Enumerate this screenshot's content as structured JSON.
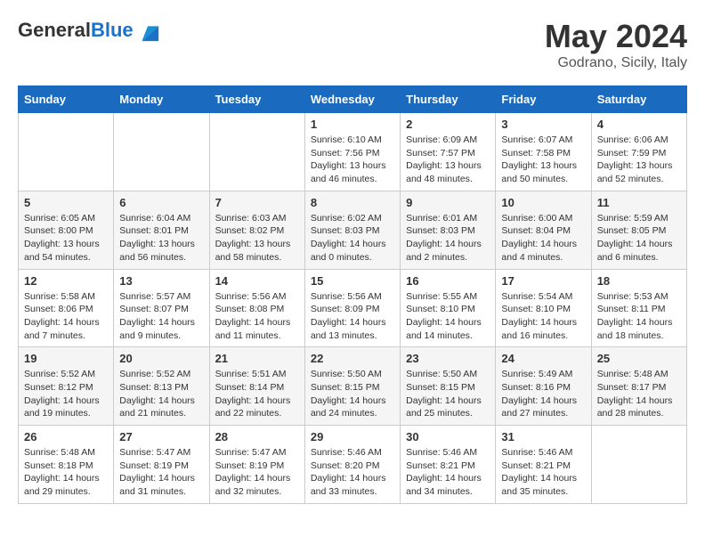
{
  "header": {
    "logo_general": "General",
    "logo_blue": "Blue",
    "month": "May 2024",
    "location": "Godrano, Sicily, Italy"
  },
  "weekdays": [
    "Sunday",
    "Monday",
    "Tuesday",
    "Wednesday",
    "Thursday",
    "Friday",
    "Saturday"
  ],
  "weeks": [
    [
      {
        "day": "",
        "sunrise": "",
        "sunset": "",
        "daylight": ""
      },
      {
        "day": "",
        "sunrise": "",
        "sunset": "",
        "daylight": ""
      },
      {
        "day": "",
        "sunrise": "",
        "sunset": "",
        "daylight": ""
      },
      {
        "day": "1",
        "sunrise": "Sunrise: 6:10 AM",
        "sunset": "Sunset: 7:56 PM",
        "daylight": "Daylight: 13 hours and 46 minutes."
      },
      {
        "day": "2",
        "sunrise": "Sunrise: 6:09 AM",
        "sunset": "Sunset: 7:57 PM",
        "daylight": "Daylight: 13 hours and 48 minutes."
      },
      {
        "day": "3",
        "sunrise": "Sunrise: 6:07 AM",
        "sunset": "Sunset: 7:58 PM",
        "daylight": "Daylight: 13 hours and 50 minutes."
      },
      {
        "day": "4",
        "sunrise": "Sunrise: 6:06 AM",
        "sunset": "Sunset: 7:59 PM",
        "daylight": "Daylight: 13 hours and 52 minutes."
      }
    ],
    [
      {
        "day": "5",
        "sunrise": "Sunrise: 6:05 AM",
        "sunset": "Sunset: 8:00 PM",
        "daylight": "Daylight: 13 hours and 54 minutes."
      },
      {
        "day": "6",
        "sunrise": "Sunrise: 6:04 AM",
        "sunset": "Sunset: 8:01 PM",
        "daylight": "Daylight: 13 hours and 56 minutes."
      },
      {
        "day": "7",
        "sunrise": "Sunrise: 6:03 AM",
        "sunset": "Sunset: 8:02 PM",
        "daylight": "Daylight: 13 hours and 58 minutes."
      },
      {
        "day": "8",
        "sunrise": "Sunrise: 6:02 AM",
        "sunset": "Sunset: 8:03 PM",
        "daylight": "Daylight: 14 hours and 0 minutes."
      },
      {
        "day": "9",
        "sunrise": "Sunrise: 6:01 AM",
        "sunset": "Sunset: 8:03 PM",
        "daylight": "Daylight: 14 hours and 2 minutes."
      },
      {
        "day": "10",
        "sunrise": "Sunrise: 6:00 AM",
        "sunset": "Sunset: 8:04 PM",
        "daylight": "Daylight: 14 hours and 4 minutes."
      },
      {
        "day": "11",
        "sunrise": "Sunrise: 5:59 AM",
        "sunset": "Sunset: 8:05 PM",
        "daylight": "Daylight: 14 hours and 6 minutes."
      }
    ],
    [
      {
        "day": "12",
        "sunrise": "Sunrise: 5:58 AM",
        "sunset": "Sunset: 8:06 PM",
        "daylight": "Daylight: 14 hours and 7 minutes."
      },
      {
        "day": "13",
        "sunrise": "Sunrise: 5:57 AM",
        "sunset": "Sunset: 8:07 PM",
        "daylight": "Daylight: 14 hours and 9 minutes."
      },
      {
        "day": "14",
        "sunrise": "Sunrise: 5:56 AM",
        "sunset": "Sunset: 8:08 PM",
        "daylight": "Daylight: 14 hours and 11 minutes."
      },
      {
        "day": "15",
        "sunrise": "Sunrise: 5:56 AM",
        "sunset": "Sunset: 8:09 PM",
        "daylight": "Daylight: 14 hours and 13 minutes."
      },
      {
        "day": "16",
        "sunrise": "Sunrise: 5:55 AM",
        "sunset": "Sunset: 8:10 PM",
        "daylight": "Daylight: 14 hours and 14 minutes."
      },
      {
        "day": "17",
        "sunrise": "Sunrise: 5:54 AM",
        "sunset": "Sunset: 8:10 PM",
        "daylight": "Daylight: 14 hours and 16 minutes."
      },
      {
        "day": "18",
        "sunrise": "Sunrise: 5:53 AM",
        "sunset": "Sunset: 8:11 PM",
        "daylight": "Daylight: 14 hours and 18 minutes."
      }
    ],
    [
      {
        "day": "19",
        "sunrise": "Sunrise: 5:52 AM",
        "sunset": "Sunset: 8:12 PM",
        "daylight": "Daylight: 14 hours and 19 minutes."
      },
      {
        "day": "20",
        "sunrise": "Sunrise: 5:52 AM",
        "sunset": "Sunset: 8:13 PM",
        "daylight": "Daylight: 14 hours and 21 minutes."
      },
      {
        "day": "21",
        "sunrise": "Sunrise: 5:51 AM",
        "sunset": "Sunset: 8:14 PM",
        "daylight": "Daylight: 14 hours and 22 minutes."
      },
      {
        "day": "22",
        "sunrise": "Sunrise: 5:50 AM",
        "sunset": "Sunset: 8:15 PM",
        "daylight": "Daylight: 14 hours and 24 minutes."
      },
      {
        "day": "23",
        "sunrise": "Sunrise: 5:50 AM",
        "sunset": "Sunset: 8:15 PM",
        "daylight": "Daylight: 14 hours and 25 minutes."
      },
      {
        "day": "24",
        "sunrise": "Sunrise: 5:49 AM",
        "sunset": "Sunset: 8:16 PM",
        "daylight": "Daylight: 14 hours and 27 minutes."
      },
      {
        "day": "25",
        "sunrise": "Sunrise: 5:48 AM",
        "sunset": "Sunset: 8:17 PM",
        "daylight": "Daylight: 14 hours and 28 minutes."
      }
    ],
    [
      {
        "day": "26",
        "sunrise": "Sunrise: 5:48 AM",
        "sunset": "Sunset: 8:18 PM",
        "daylight": "Daylight: 14 hours and 29 minutes."
      },
      {
        "day": "27",
        "sunrise": "Sunrise: 5:47 AM",
        "sunset": "Sunset: 8:19 PM",
        "daylight": "Daylight: 14 hours and 31 minutes."
      },
      {
        "day": "28",
        "sunrise": "Sunrise: 5:47 AM",
        "sunset": "Sunset: 8:19 PM",
        "daylight": "Daylight: 14 hours and 32 minutes."
      },
      {
        "day": "29",
        "sunrise": "Sunrise: 5:46 AM",
        "sunset": "Sunset: 8:20 PM",
        "daylight": "Daylight: 14 hours and 33 minutes."
      },
      {
        "day": "30",
        "sunrise": "Sunrise: 5:46 AM",
        "sunset": "Sunset: 8:21 PM",
        "daylight": "Daylight: 14 hours and 34 minutes."
      },
      {
        "day": "31",
        "sunrise": "Sunrise: 5:46 AM",
        "sunset": "Sunset: 8:21 PM",
        "daylight": "Daylight: 14 hours and 35 minutes."
      },
      {
        "day": "",
        "sunrise": "",
        "sunset": "",
        "daylight": ""
      }
    ]
  ]
}
